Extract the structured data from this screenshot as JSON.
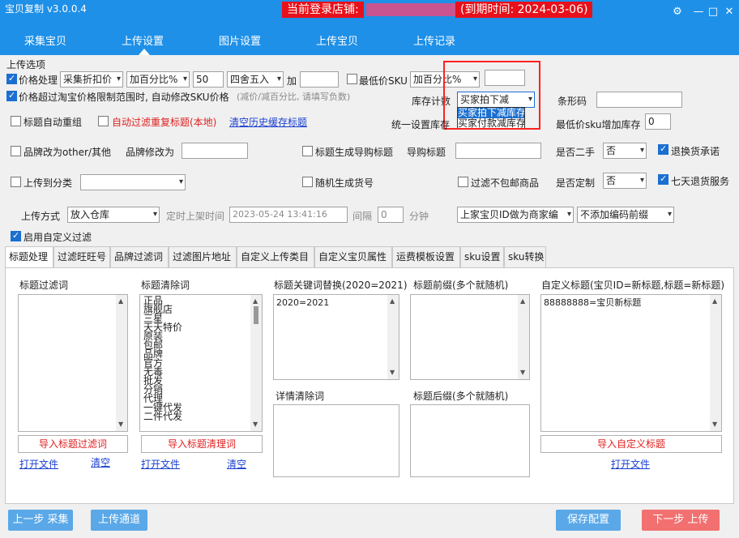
{
  "app": {
    "title": "宝贝复制 v3.0.0.4"
  },
  "banner": {
    "store_label": "当前登录店铺:",
    "expiry_label": "(到期时间: 2024-03-06)"
  },
  "window_controls": {
    "settings": "⚙",
    "minimize": "—",
    "maximize": "□",
    "close": "✕"
  },
  "nav": {
    "tabs": [
      "采集宝贝",
      "上传设置",
      "图片设置",
      "上传宝贝",
      "上传记录"
    ],
    "active": "上传设置"
  },
  "upload_options": {
    "group_label": "上传选项",
    "price_process": {
      "label": "价格处理",
      "checked": true,
      "mode": "采集折扣价",
      "calc": "加百分比%",
      "value": "50",
      "rounding": "四舍五入",
      "add_label": "加",
      "add_value": ""
    },
    "min_sku": {
      "label": "最低价SKU",
      "checked": false,
      "calc": "加百分比%",
      "value": ""
    },
    "exceed_limit": {
      "label": "价格超过淘宝价格限制范围时, 自动修改SKU价格",
      "hint": "(减价/减百分比, 请填写负数)",
      "checked": true
    },
    "inventory": {
      "label": "库存计数",
      "selected": "买家拍下减",
      "options": [
        "买家拍下减库存",
        "买家付款减库存"
      ]
    },
    "barcode": {
      "label": "条形码",
      "value": ""
    },
    "title_regroup": {
      "label": "标题自动重组",
      "checked": false
    },
    "auto_filter_dup": {
      "label": "自动过滤重复标题(本地)",
      "checked": false
    },
    "clear_history": "清空历史缓存标题",
    "unified_stock": {
      "label": "统一设置库存"
    },
    "min_sku_stock": {
      "label": "最低价sku增加库存",
      "value": "0"
    },
    "brand_other": {
      "label": "品牌改为other/其他",
      "checked": false
    },
    "brand_modify": {
      "label": "品牌修改为",
      "value": ""
    },
    "guide_title": {
      "label": "标题生成导购标题",
      "checked": false
    },
    "guide_label": "导购标题",
    "guide_value": "",
    "second_hand": {
      "label": "是否二手",
      "value": "否"
    },
    "return_promise": {
      "label": "退换货承诺",
      "checked": true
    },
    "upload_category": {
      "label": "上传到分类",
      "checked": false,
      "value": ""
    },
    "random_code": {
      "label": "随机生成货号",
      "checked": false
    },
    "filter_no_shipping": {
      "label": "过滤不包邮商品",
      "checked": false
    },
    "custom_made": {
      "label": "是否定制",
      "value": "否"
    },
    "seven_day": {
      "label": "七天退货服务",
      "checked": true
    },
    "upload_mode": {
      "label": "上传方式",
      "value": "放入仓库"
    },
    "timed": {
      "label": "定时上架时间",
      "value": "2023-05-24 13:41:16"
    },
    "interval": {
      "label": "间隔",
      "value": "0",
      "unit": "分钟"
    },
    "merchant_code": {
      "value": "上家宝贝ID做为商家编"
    },
    "prefix": {
      "value": "不添加编码前缀"
    },
    "custom_filter": {
      "label": "启用自定义过滤",
      "checked": true
    }
  },
  "tabs": [
    "标题处理",
    "过滤旺旺号",
    "品牌过滤词",
    "过滤图片地址",
    "自定义上传类目",
    "自定义宝贝属性",
    "运费模板设置",
    "sku设置",
    "sku转换"
  ],
  "title_panel": {
    "filter_words": {
      "label": "标题过滤词",
      "items": []
    },
    "clean_words": {
      "label": "标题清除词",
      "items": [
        "正品",
        "旗舰店",
        "三星",
        "天天特价",
        "原装",
        "包邮",
        "品牌",
        "官方",
        "无毒",
        "批发",
        "分销",
        "代理",
        "一键代发",
        "二件代发"
      ]
    },
    "keyword_replace": {
      "label": "标题关键词替换(2020=2021)",
      "items": [
        "2020=2021"
      ]
    },
    "prefix": {
      "label": "标题前缀(多个就随机)",
      "items": []
    },
    "custom_title": {
      "label": "自定义标题(宝贝ID=新标题,标题=新标题)",
      "items": [
        "88888888=宝贝新标题"
      ]
    },
    "detail_clean": {
      "label": "详情清除词",
      "items": []
    },
    "suffix": {
      "label": "标题后缀(多个就随机)",
      "items": []
    },
    "import_filter": "导入标题过滤词",
    "import_clean": "导入标题清理词",
    "import_custom": "导入自定义标题",
    "open_file": "打开文件",
    "clear": "清空"
  },
  "footer": {
    "prev": "上一步 采集",
    "channel": "上传通道",
    "save": "保存配置",
    "next": "下一步 上传"
  },
  "colors": {
    "accent": "#1e90e8",
    "banner_red": "#e8101a",
    "next_btn": "#f27070",
    "save_btn": "#5aa8e8",
    "highlight_box": "#ff2020"
  }
}
